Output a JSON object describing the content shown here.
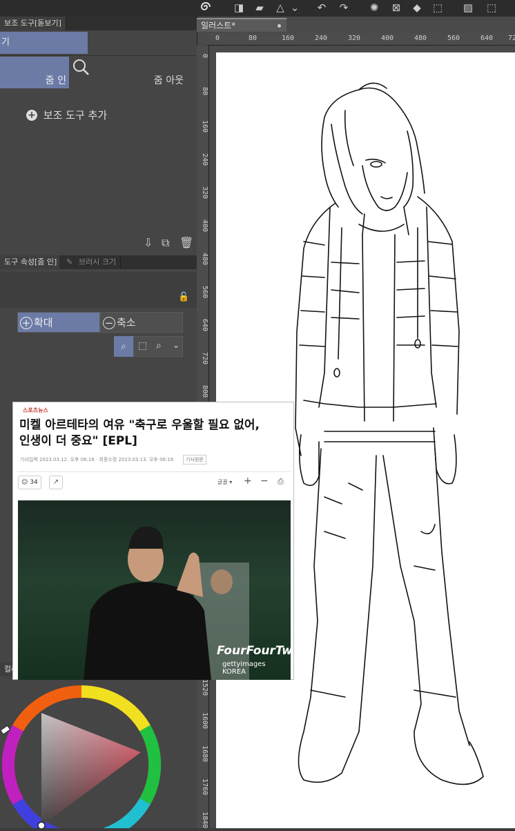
{
  "toolbar": {
    "icons": [
      "spiral-icon",
      "transform-icon",
      "fill-icon",
      "warning-icon",
      "chevron-down-icon",
      "undo-icon",
      "redo-icon",
      "loading-icon",
      "clear-icon",
      "bucket-icon",
      "select-icon",
      "hatch-icon",
      "selection-clear-icon"
    ]
  },
  "subtool_panel": {
    "tab_label": "보조 도구[돋보기]",
    "group_label": "기",
    "zoom_in_label": "줌 인",
    "zoom_out_label": "줌 아웃",
    "add_subtool_label": "보조 도구 추가"
  },
  "property_panel": {
    "tab_label": "도구 속성[줌 인]",
    "tab2_label": "브러시 크기",
    "enlarge_label": "확대",
    "shrink_label": "축소"
  },
  "color_panel": {
    "tab_label": "컬러"
  },
  "document": {
    "tab_label": "일러스트*"
  },
  "rulers": {
    "horizontal": [
      "0",
      "80",
      "160",
      "240",
      "320",
      "400",
      "480",
      "560",
      "640",
      "72"
    ],
    "vertical": [
      "0",
      "80",
      "160",
      "240",
      "320",
      "400",
      "480",
      "560",
      "640",
      "720",
      "800",
      "1520",
      "1600",
      "1680",
      "1760",
      "1840"
    ]
  },
  "news": {
    "logo": "스포츠뉴스",
    "headline_line1": "미켈 아르테타의 여유 \"축구로 우울할 필요 없어,",
    "headline_line2": "인생이 더 중요\" [EPL]",
    "meta": "기사입력 2023.03.12. 오후 06:16 · 최종수정 2023.03.13. 오후 06:16",
    "meta_button": "기사원문",
    "reaction_count": "34",
    "font_label": "글꼴",
    "photo_watermark_1": "FourFourTwo",
    "photo_watermark_2": "gettyimages KOREA"
  },
  "colors": {
    "accent_blue": "#6b7ba6",
    "panel": "#454545",
    "dark": "#2c2c2c"
  }
}
